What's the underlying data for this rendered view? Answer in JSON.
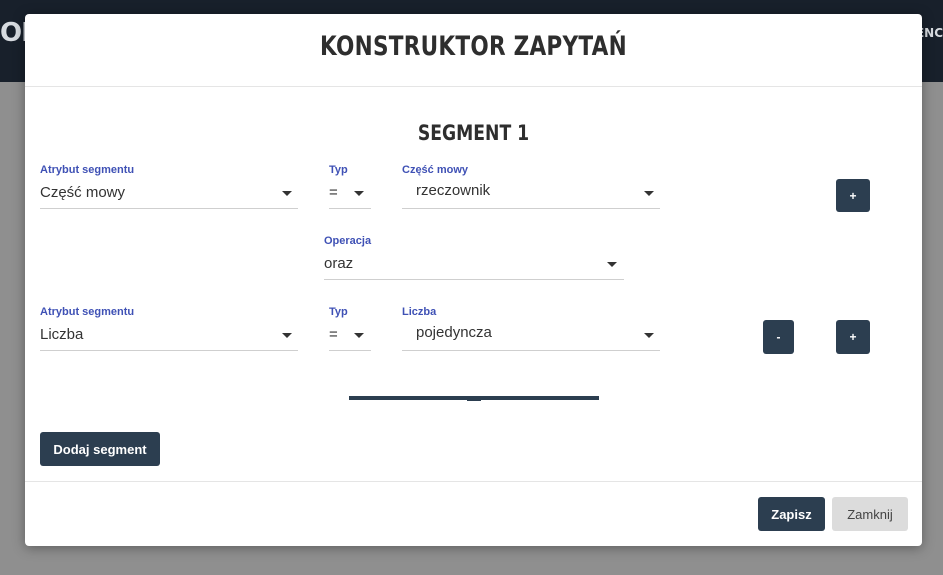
{
  "background": {
    "logo_fragment": "OM",
    "nav_fragment": "ENC"
  },
  "modal": {
    "title": "KONSTRUKTOR ZAPYTAŃ"
  },
  "segment": {
    "title": "SEGMENT 1",
    "row1": {
      "attribute_label": "Atrybut segmentu",
      "attribute_value": "Część mowy",
      "type_label": "Typ",
      "type_value": "=",
      "value_label": "Część mowy",
      "value_value": "rzeczownik",
      "add_label": "+"
    },
    "operation": {
      "label": "Operacja",
      "value": "oraz"
    },
    "row2": {
      "attribute_label": "Atrybut segmentu",
      "attribute_value": "Liczba",
      "type_label": "Typ",
      "type_value": "=",
      "value_label": "Liczba",
      "value_value": "pojedyncza",
      "remove_label": "-",
      "add_label": "+"
    }
  },
  "actions": {
    "add_segment_label": "Dodaj segment",
    "save_label": "Zapisz",
    "close_label": "Zamknij"
  },
  "colors": {
    "accent_dark": "#2c3e50",
    "label_blue": "#3f51b5",
    "backdrop": "#8f8f8f"
  }
}
